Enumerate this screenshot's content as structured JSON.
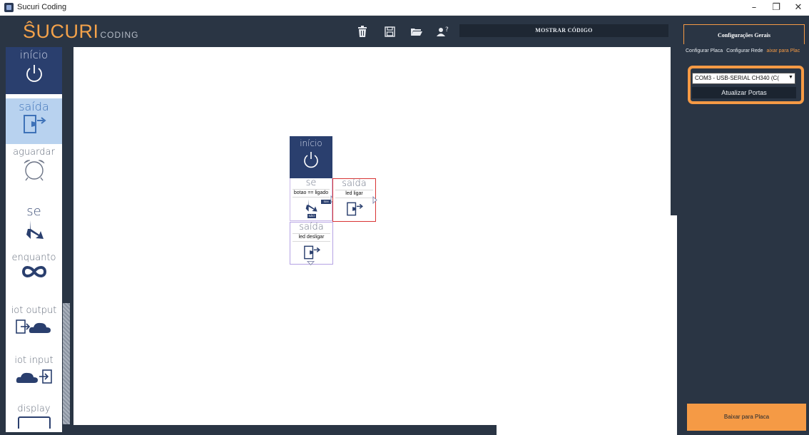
{
  "window": {
    "title": "Sucuri Coding",
    "controls": [
      "–",
      "❐",
      "✕"
    ]
  },
  "header": {
    "logo_main": "ŜUCURI",
    "logo_sub": "CODING",
    "toolbar_icons": [
      "trash-icon",
      "save-icon",
      "folder-open-icon",
      "user-help-icon"
    ],
    "show_code_label": "MOSTRAR CÓDIGO",
    "general_tab_label": "Configurações Gerais"
  },
  "palette": {
    "items": [
      {
        "label": "início",
        "icon": "power-icon"
      },
      {
        "label": "saída",
        "icon": "exit-door-icon"
      },
      {
        "label": "aguardar",
        "icon": "alarm-clock-icon"
      },
      {
        "label": "se",
        "icon": "fork-arrow-icon"
      },
      {
        "label": "enquanto",
        "icon": "infinity-icon"
      },
      {
        "label": "iot output",
        "icon": "cloud-upload-icon"
      },
      {
        "label": "iot input",
        "icon": "cloud-download-icon"
      },
      {
        "label": "display",
        "icon": "display-icon"
      }
    ]
  },
  "canvas": {
    "blocks": {
      "inicio": {
        "title": "início"
      },
      "se": {
        "title": "se",
        "condition": "botao == ligado",
        "yes_label": "SIM",
        "no_label": "NÃO"
      },
      "saida_on": {
        "title": "saída",
        "param": "led ligar"
      },
      "saida_off": {
        "title": "saída",
        "param": "led desligar"
      }
    }
  },
  "settings": {
    "subtabs": [
      "Configurar Placa",
      "Configurar Rede",
      "aixar para Plac"
    ],
    "port_value": "COM3 - USB-SERIAL CH340 (C(",
    "refresh_label": "Atualizar Portas",
    "upload_label": "Baixar para Placa"
  },
  "colors": {
    "accent": "#f59a45",
    "dark": "#2a3544",
    "start_block": "#2a3f6e",
    "selected": "#b8d2ef"
  }
}
